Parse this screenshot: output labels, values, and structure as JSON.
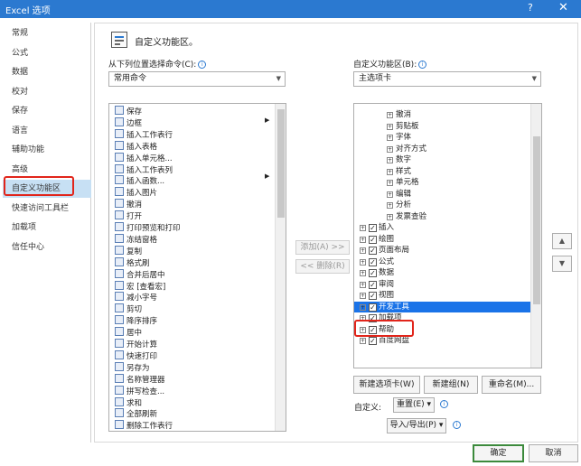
{
  "window": {
    "title": "Excel 选项",
    "help": "?",
    "close": "✕"
  },
  "nav": {
    "items": [
      "常规",
      "公式",
      "数据",
      "校对",
      "保存",
      "语言",
      "辅助功能",
      "高级",
      "自定义功能区",
      "快速访问工具栏",
      "加载项",
      "信任中心"
    ],
    "selected": "自定义功能区"
  },
  "header": {
    "title": "自定义功能区。"
  },
  "left_panel": {
    "label": "从下列位置选择命令(C):",
    "dropdown_value": "常用命令",
    "commands": [
      "保存",
      "边框",
      "插入工作表行",
      "插入表格",
      "插入单元格...",
      "插入工作表列",
      "插入函数...",
      "插入图片",
      "撤消",
      "打开",
      "打印预览和打印",
      "冻结窗格",
      "复制",
      "格式刷",
      "合并后居中",
      "宏 [查看宏]",
      "减小字号",
      "剪切",
      "降序排序",
      "居中",
      "开始计算",
      "快速打印",
      "另存为",
      "名称管理器",
      "拼写检查...",
      "求和",
      "全部刷新",
      "删除工作表行"
    ]
  },
  "middle": {
    "add_label": "添加(A) >>",
    "remove_label": "<< 删除(R)"
  },
  "right_panel": {
    "label": "自定义功能区(B):",
    "dropdown_value": "主选项卡",
    "tree": [
      {
        "label": "撤消",
        "level": 2
      },
      {
        "label": "剪贴板",
        "level": 2
      },
      {
        "label": "字体",
        "level": 2
      },
      {
        "label": "对齐方式",
        "level": 2
      },
      {
        "label": "数字",
        "level": 2
      },
      {
        "label": "样式",
        "level": 2
      },
      {
        "label": "单元格",
        "level": 2
      },
      {
        "label": "编辑",
        "level": 2
      },
      {
        "label": "分析",
        "level": 2
      },
      {
        "label": "发票查验",
        "level": 2
      },
      {
        "label": "插入",
        "level": 1,
        "checked": true
      },
      {
        "label": "绘图",
        "level": 1,
        "checked": true
      },
      {
        "label": "页面布局",
        "level": 1,
        "checked": true
      },
      {
        "label": "公式",
        "level": 1,
        "checked": true
      },
      {
        "label": "数据",
        "level": 1,
        "checked": true
      },
      {
        "label": "审阅",
        "level": 1,
        "checked": true
      },
      {
        "label": "视图",
        "level": 1,
        "checked": true
      },
      {
        "label": "开发工具",
        "level": 1,
        "checked": true,
        "selected": true
      },
      {
        "label": "加载项",
        "level": 1,
        "checked": true
      },
      {
        "label": "帮助",
        "level": 1,
        "checked": true
      },
      {
        "label": "百度网盘",
        "level": 1,
        "checked": true
      }
    ],
    "new_tab": "新建选项卡(W)",
    "new_group": "新建组(N)",
    "rename": "重命名(M)...",
    "customize_label": "自定义:",
    "reset": "重置(E) ▾",
    "import_export": "导入/导出(P) ▾"
  },
  "footer": {
    "ok": "确定",
    "cancel": "取消"
  },
  "colors": {
    "titlebar": "#2b79d0",
    "selection": "#c7e0f4",
    "tree_selection": "#1a73e8",
    "highlight_box": "#e1251b",
    "ok_border": "#3c8a3c"
  }
}
